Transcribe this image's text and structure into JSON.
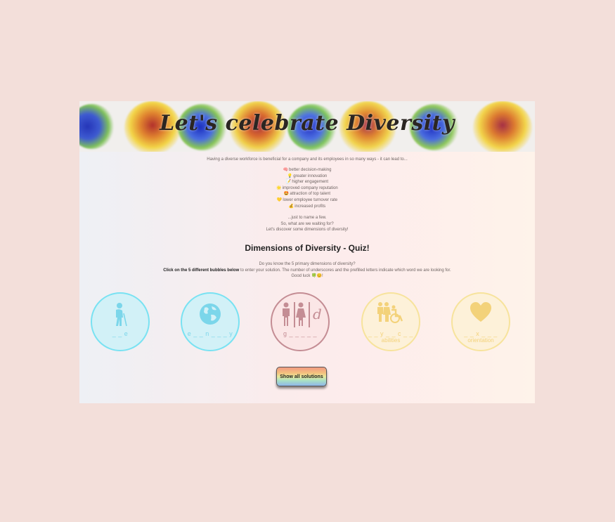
{
  "banner": {
    "title": "Let's celebrate Diversity"
  },
  "intro": "Having a diverse workforce is beneficial for a company and its employees in so many ways - it can lead to...",
  "benefits": [
    {
      "icon": "🧠",
      "text": "better decision-making"
    },
    {
      "icon": "💡",
      "text": "greater innovation"
    },
    {
      "icon": "📝",
      "text": "higher engagement"
    },
    {
      "icon": "🌟",
      "text": "improved company reputation"
    },
    {
      "icon": "🤩",
      "text": "attraction of top talent"
    },
    {
      "icon": "💛",
      "text": "lower employee turnover rate"
    },
    {
      "icon": "💰",
      "text": "increased profits"
    }
  ],
  "outro": [
    "...just to name a few.",
    "So, what are we waiting for?",
    "Let's discover some dimensions of diversity!"
  ],
  "quiz": {
    "title": "Dimensions of Diversity - Quiz!",
    "line1": "Do you know the 5 primary dimensions of diversity?",
    "line2_bold": "Click on the 5 different bubbles below",
    "line2_rest": " to enter your solution. The number of underscores and the prefilled letters indicate which word we are looking for.",
    "line3": "Good luck 🍀😊!"
  },
  "bubbles": [
    {
      "icon": "elderly-person-icon",
      "hint": "_ _ e",
      "word": ""
    },
    {
      "icon": "globe-icon",
      "hint": "e _ _ n _ _ _ y",
      "word": ""
    },
    {
      "icon": "gender-icon",
      "hint": "g _ _ _ _ _",
      "word": ""
    },
    {
      "icon": "family-wheelchair-icon",
      "hint": "_ _ y _ _ c _ _",
      "word": "abilities"
    },
    {
      "icon": "heart-icon",
      "hint": "_ _ x _ _ _",
      "word": "orientation"
    }
  ],
  "button": {
    "label": "Show all solutions"
  },
  "colors": {
    "cyan": "#79e2f2",
    "rose": "#c48d94",
    "yellow": "#f7e39c",
    "page_bg": "#f3dfda"
  }
}
